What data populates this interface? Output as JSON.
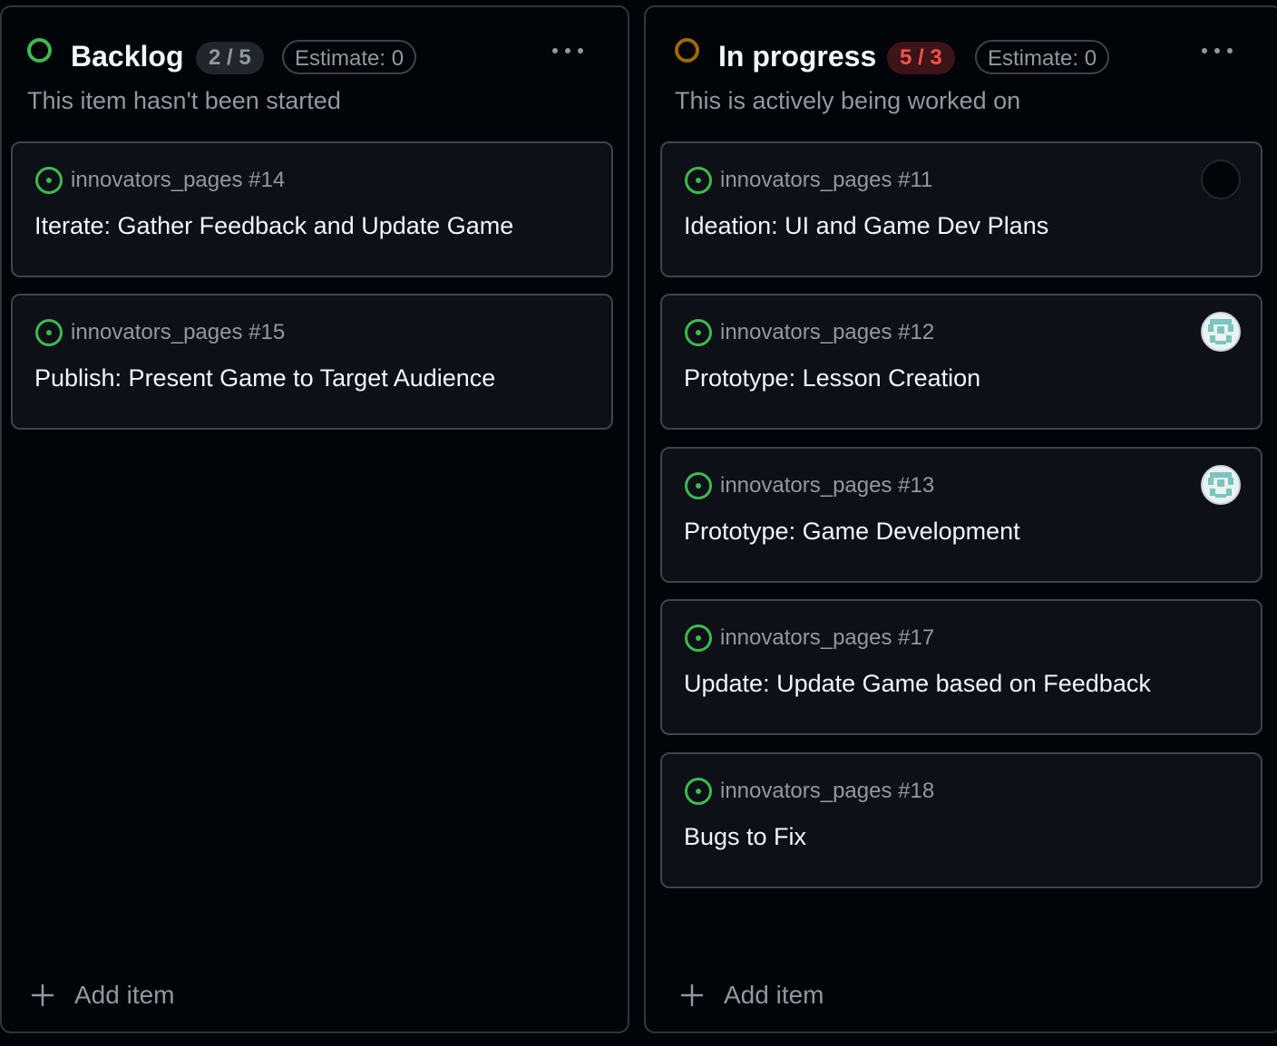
{
  "columns": [
    {
      "title": "Backlog",
      "count": "2 / 5",
      "estimate": "Estimate: 0",
      "description": "This item hasn't been started",
      "status_color": "#3fb950",
      "cards": [
        {
          "ref": "innovators_pages #14",
          "title": "Iterate: Gather Feedback and Update Game",
          "assignee": "none"
        },
        {
          "ref": "innovators_pages #15",
          "title": "Publish: Present Game to Target Audience",
          "assignee": "none"
        }
      ],
      "add_label": "Add item"
    },
    {
      "title": "In progress",
      "count": "5 / 3",
      "estimate": "Estimate: 0",
      "description": "This is actively being worked on",
      "status_color": "#9e6a03",
      "count_color": "#f85149",
      "cards": [
        {
          "ref": "innovators_pages #11",
          "title": "Ideation: UI and Game Dev Plans",
          "assignee": "empty-avatar"
        },
        {
          "ref": "innovators_pages #12",
          "title": "Prototype: Lesson Creation",
          "assignee": "identicon-avatar"
        },
        {
          "ref": "innovators_pages #13",
          "title": "Prototype: Game Development",
          "assignee": "identicon-avatar"
        },
        {
          "ref": "innovators_pages #17",
          "title": "Update: Update Game based on Feedback",
          "assignee": "none"
        },
        {
          "ref": "innovators_pages #18",
          "title": "Bugs to Fix",
          "assignee": "none"
        }
      ],
      "add_label": "Add item"
    }
  ],
  "icons": {
    "status": "circle-status-icon",
    "issue": "open-issue-icon",
    "more": "kebab-horizontal-icon",
    "add": "plus-icon"
  },
  "colors": {
    "background": "#010409",
    "card_bg": "#0d1117",
    "border": "#3d444d",
    "open_issue_green": "#3fb950"
  }
}
